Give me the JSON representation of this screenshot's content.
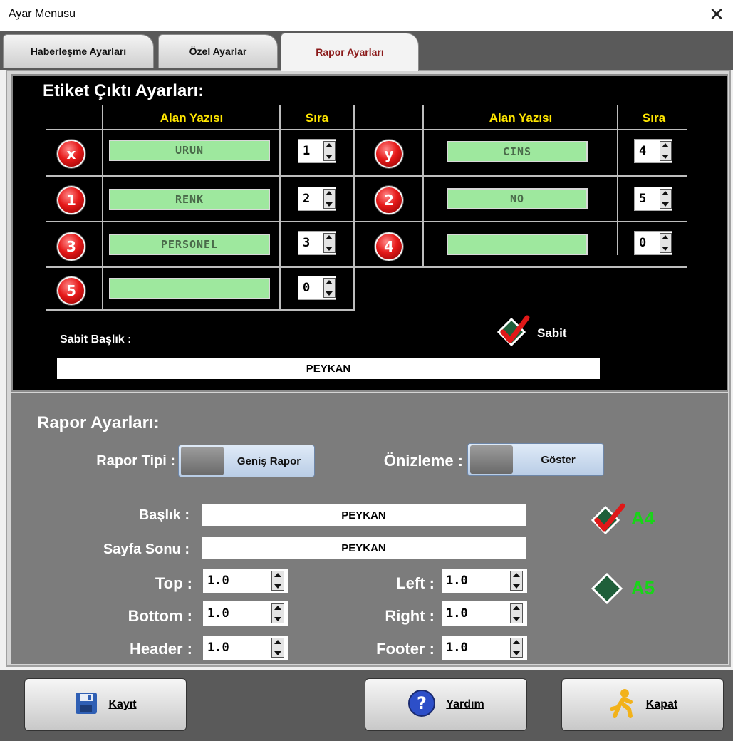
{
  "window": {
    "title": "Ayar Menusu",
    "close_glyph": "✕"
  },
  "tabs": [
    {
      "label": "Haberleşme Ayarları",
      "active": false
    },
    {
      "label": "Özel Ayarlar",
      "active": false
    },
    {
      "label": "Rapor Ayarları",
      "active": true
    }
  ],
  "etiket": {
    "title": "Etiket Çıktı Ayarları:",
    "col_alan": "Alan Yazısı",
    "col_sira": "Sıra",
    "left_rows": [
      {
        "badge": "x",
        "field": "URUN",
        "sira": "1"
      },
      {
        "badge": "1",
        "field": "RENK",
        "sira": "2"
      },
      {
        "badge": "3",
        "field": "PERSONEL",
        "sira": "3"
      },
      {
        "badge": "5",
        "field": "",
        "sira": "0"
      }
    ],
    "right_rows": [
      {
        "badge": "y",
        "field": "CINS",
        "sira": "4"
      },
      {
        "badge": "2",
        "field": "NO",
        "sira": "5"
      },
      {
        "badge": "4",
        "field": "",
        "sira": "0"
      }
    ],
    "sabit_baslik_label": "Sabit Başlık :",
    "sabit_baslik_value": "PEYKAN",
    "sabit_label": "Sabit",
    "sabit_checked": true
  },
  "rapor": {
    "title": "Rapor Ayarları:",
    "rapor_tipi_label": "Rapor Tipi :",
    "rapor_tipi_value": "Geniş Rapor",
    "onizleme_label": "Önizleme :",
    "onizleme_value": "Göster",
    "baslik_label": "Başlık :",
    "baslik_value": "PEYKAN",
    "sayfa_sonu_label": "Sayfa Sonu :",
    "sayfa_sonu_value": "PEYKAN",
    "top_label": "Top :",
    "top_value": "1.0",
    "bottom_label": "Bottom :",
    "bottom_value": "1.0",
    "header_label": "Header :",
    "header_value": "1.0",
    "left_label": "Left :",
    "left_value": "1.0",
    "right_label": "Right :",
    "right_value": "1.0",
    "footer_label": "Footer :",
    "footer_value": "1.0",
    "a4_label": "A4",
    "a4_checked": true,
    "a5_label": "A5",
    "a5_checked": false,
    "paper_label_color": "#19d419"
  },
  "buttons": {
    "kayit": {
      "label": "Kayıt",
      "icon": "floppy-disk-icon"
    },
    "yardim": {
      "label": "Yardım",
      "icon": "help-icon"
    },
    "kapat": {
      "label": "Kapat",
      "icon": "running-man-icon"
    }
  }
}
